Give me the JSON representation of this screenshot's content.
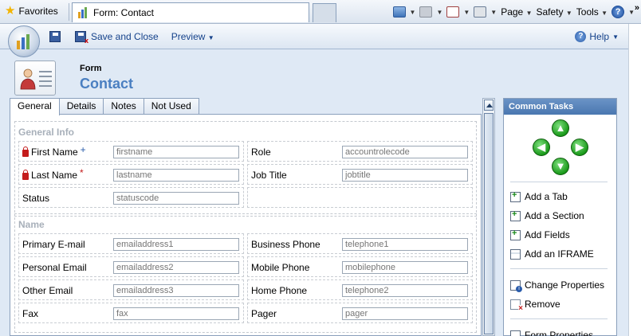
{
  "browser": {
    "favorites_label": "Favorites",
    "tab_title": "Form: Contact",
    "commands": {
      "page": "Page",
      "safety": "Safety",
      "tools": "Tools"
    },
    "overflow": "»"
  },
  "app_toolbar": {
    "save_and_close": "Save and Close",
    "preview": "Preview",
    "help": "Help"
  },
  "form": {
    "kind": "Form",
    "title": "Contact",
    "tabs": [
      {
        "label": "General",
        "active": true
      },
      {
        "label": "Details",
        "active": false
      },
      {
        "label": "Notes",
        "active": false
      },
      {
        "label": "Not Used",
        "active": false
      }
    ],
    "sections": [
      {
        "title": "General Info",
        "fields": [
          {
            "label": "First Name",
            "marker": "+",
            "locked": true,
            "placeholder": "firstname"
          },
          {
            "label": "Role",
            "placeholder": "accountrolecode"
          },
          {
            "label": "Last Name",
            "marker": "*",
            "locked": true,
            "placeholder": "lastname"
          },
          {
            "label": "Job Title",
            "placeholder": "jobtitle"
          },
          {
            "label": "Status",
            "placeholder": "statuscode"
          }
        ]
      },
      {
        "title": "Name",
        "fields": [
          {
            "label": "Primary E-mail",
            "placeholder": "emailaddress1"
          },
          {
            "label": "Business Phone",
            "placeholder": "telephone1"
          },
          {
            "label": "Personal Email",
            "placeholder": "emailaddress2"
          },
          {
            "label": "Mobile Phone",
            "placeholder": "mobilephone"
          },
          {
            "label": "Other Email",
            "placeholder": "emailaddress3"
          },
          {
            "label": "Home Phone",
            "placeholder": "telephone2"
          },
          {
            "label": "Fax",
            "placeholder": "fax"
          },
          {
            "label": "Pager",
            "placeholder": "pager"
          }
        ]
      }
    ]
  },
  "tasks": {
    "title": "Common Tasks",
    "items": [
      {
        "label": "Add a Tab",
        "icon": "add-tab-icon"
      },
      {
        "label": "Add a Section",
        "icon": "add-section-icon"
      },
      {
        "label": "Add Fields",
        "icon": "add-fields-icon"
      },
      {
        "label": "Add an IFRAME",
        "icon": "add-iframe-icon"
      },
      {
        "label": "Change Properties",
        "icon": "properties-icon"
      },
      {
        "label": "Remove",
        "icon": "remove-icon"
      },
      {
        "label": "Form Properties",
        "icon": "form-properties-icon"
      }
    ]
  },
  "colors": {
    "accent": "#4a7fc1",
    "required": "#c41c1c",
    "placeholder": "#b8bec7",
    "task_header": "#5a85bb"
  }
}
